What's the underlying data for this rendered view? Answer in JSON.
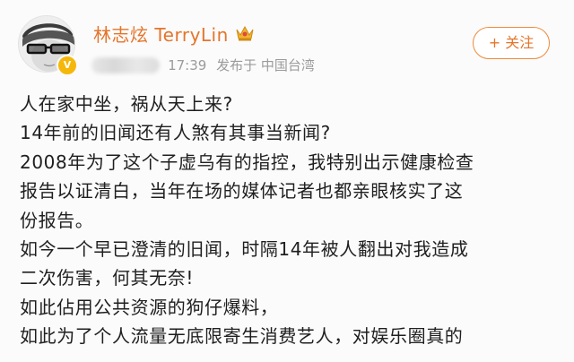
{
  "author": {
    "name": "林志炫 TerryLin",
    "verified_badge": "V",
    "badge_color": "#f6b70b",
    "name_color": "#e4752b",
    "crown_icon": "gold-crown-icon"
  },
  "meta": {
    "time": "17:39",
    "source": "发布于 中国台湾"
  },
  "follow_label": "+ 关注",
  "post_lines": [
    "人在家中坐，祸从天上来?",
    "14年前的旧闻还有人煞有其事当新闻?",
    "2008年为了这个子虚乌有的指控，我特别出示健康检查",
    "报告以证清白，当年在场的媒体记者也都亲眼核实了这",
    "份报告。",
    "如今一个早已澄清的旧闻，时隔14年被人翻出对我造成",
    "二次伤害，何其无奈!",
    "如此佔用公共资源的狗仔爆料，",
    "如此为了个人流量无底限寄生消费艺人，对娱乐圈真的"
  ]
}
